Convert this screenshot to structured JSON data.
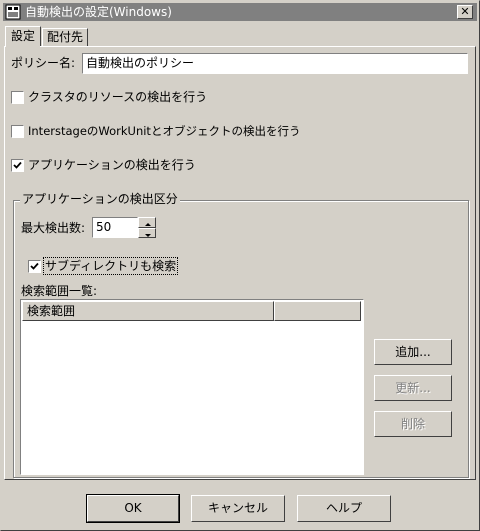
{
  "window": {
    "title": "自動検出の設定(Windows)",
    "close_glyph": "✕"
  },
  "tabs": [
    {
      "label": "設定"
    },
    {
      "label": "配付先"
    }
  ],
  "policy": {
    "label": "ポリシー名:",
    "value": "自動検出のポリシー"
  },
  "checks": [
    {
      "label": "クラスタのリソースの検出を行う",
      "checked": false
    },
    {
      "label": "InterstageのWorkUnitとオブジェクトの検出を行う",
      "checked": false
    },
    {
      "label": "アプリケーションの検出を行う",
      "checked": true
    }
  ],
  "app_group": {
    "title": "アプリケーションの検出区分",
    "max_label": "最大検出数:",
    "max_value": "50",
    "subdir_label": "サブディレクトリも検索",
    "subdir_checked": true,
    "list_label": "検索範囲一覧:",
    "list_header": "検索範囲",
    "list_items": []
  },
  "side_buttons": {
    "add": "追加...",
    "update": "更新...",
    "delete": "削除"
  },
  "bottom_buttons": {
    "ok": "OK",
    "cancel": "キャンセル",
    "help": "ヘルプ"
  },
  "colors": {
    "titlebar_inactive": "#808080",
    "face": "#d4d0c8"
  },
  "icons": {
    "window": "app-icon",
    "close": "close-icon",
    "check": "check-icon",
    "spin_up": "spin-up-icon",
    "spin_down": "spin-down-icon"
  }
}
